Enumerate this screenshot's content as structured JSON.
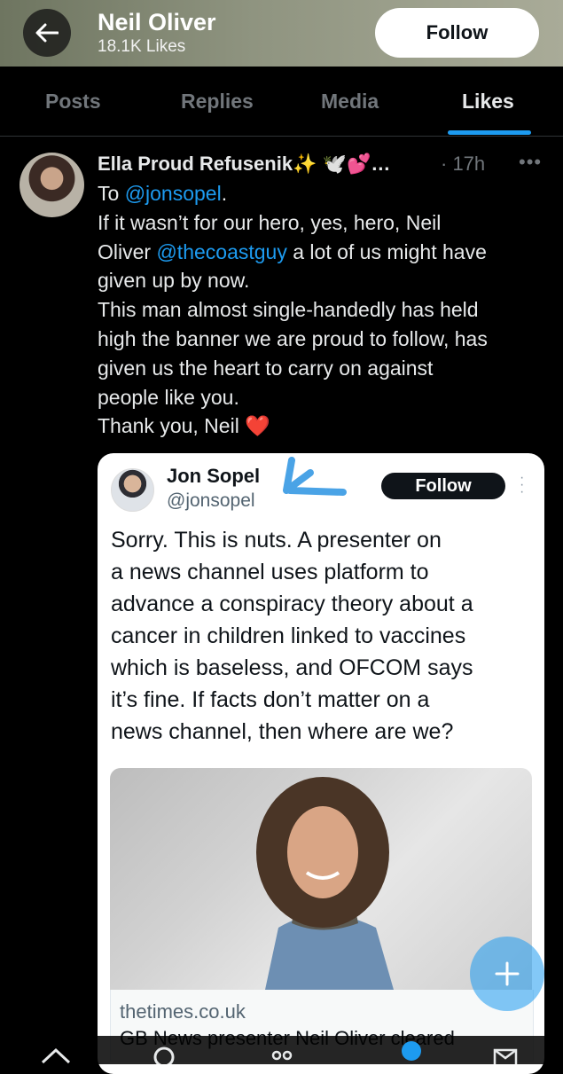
{
  "header": {
    "title": "Neil Oliver",
    "subtitle": "18.1K Likes",
    "follow_label": "Follow",
    "background": "#8f9480"
  },
  "tabs": [
    "Posts",
    "Replies",
    "Media",
    "Likes"
  ],
  "active_tab": "Likes",
  "accent_color": "#1d9bf0",
  "tweet": {
    "author": "Ella Proud Refusenik✨ 🕊️💕…",
    "time": "· 17h",
    "more": "•••",
    "body_lines": [
      {
        "text": "To ",
        "link": "@jonsopel",
        "after": "."
      },
      {
        "text": "If it wasn’t for our hero, yes, hero, Neil",
        "link": "",
        "after": ""
      },
      {
        "text": "Oliver ",
        "link": "@thecoastguy",
        "after": " a lot of us might have"
      },
      {
        "text": "given up by now.",
        "link": "",
        "after": ""
      },
      {
        "text": "This man almost single-handedly has held",
        "link": "",
        "after": ""
      },
      {
        "text": "high the banner we are proud to follow, has",
        "link": "",
        "after": ""
      },
      {
        "text": "given us the heart to carry on against",
        "link": "",
        "after": ""
      },
      {
        "text": "people like you.",
        "link": "",
        "after": ""
      },
      {
        "text": "Thank you, Neil ❤️",
        "link": "",
        "after": ""
      }
    ]
  },
  "embedded": {
    "name": "Jon Sopel",
    "handle": "@jonsopel",
    "follow_label": "Follow",
    "text_lines": [
      "Sorry. This is nuts. A presenter on",
      "a news channel uses platform to",
      "advance a conspiracy theory about a",
      "cancer in children linked to vaccines",
      "which is baseless, and OFCOM says",
      "it’s fine. If facts don’t matter on a",
      "news channel, then where are we?"
    ],
    "link_domain": "thetimes.co.uk",
    "link_headline": "GB News presenter Neil Oliver cleared"
  },
  "fab_label": "+",
  "bottom_nav": [
    "home-icon",
    "search-icon",
    "communities-icon",
    "notifications-icon",
    "messages-icon"
  ]
}
